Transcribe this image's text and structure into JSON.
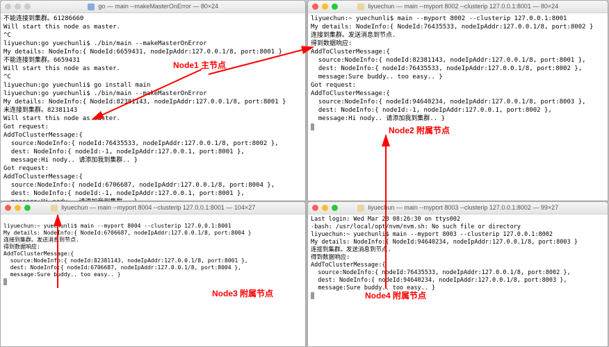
{
  "windows": {
    "tl": {
      "title": " go — main --makeMasterOnError — 80×24",
      "lights": "grey",
      "lines": [
        "不能连接到集群。61286660",
        "Will start this node as master.",
        "^C",
        "liyuechun:go yuechunli$ ./bin/main --makeMasterOnError",
        "My details: NodeInfo:{ NodeId:6659431, nodeIpAddr:127.0.0.1/8, port:8001 }",
        "不能连接到集群。6659431",
        "Will start this node as master.",
        "^C",
        "liyuechun:go yuechunli$ go install main",
        "liyuechun:go yuechunli$ ./bin/main --makeMasterOnError",
        "My details: NodeInfo:{ NodeId:82381143, nodeIpAddr:127.0.0.1/8, port:8001 }",
        "未连接到集群。82381143",
        "Will start this node as master.",
        "Got request:",
        "AddToClusterMessage:{",
        "  source:NodeInfo:{ nodeId:76435533, nodeIpAddr:127.0.0.1/8, port:8002 },",
        "  dest: NodeInfo:{ nodeId:-1, nodeIpAddr:127.0.0.1, port:8001 },",
        "  message:Hi nody.. 请添加我到集群.. }",
        "Got request:",
        "AddToClusterMessage:{",
        "  source:NodeInfo:{ nodeId:6706687, nodeIpAddr:127.0.0.1/8, port:8004 },",
        "  dest: NodeInfo:{ nodeId:-1, nodeIpAddr:127.0.0.1, port:8001 },",
        "  message:Hi nody.. 请添加我到集群.. }"
      ]
    },
    "tr": {
      "title": " liyuechun — main --myport 8002 --clusterip 127.0.0.1:8001 — 80×24",
      "lights": "color",
      "lines": [
        "liyuechun:~ yuechunli$ main --myport 8002 --clusterip 127.0.0.1:8001",
        "My details: NodeInfo:{ NodeId:76435533, nodeIpAddr:127.0.0.1/8, port:8002 }",
        "连接到集群。发送消息到节点.",
        "得到数据响应:",
        "AddToClusterMessage:{",
        "  source:NodeInfo:{ nodeId:82381143, nodeIpAddr:127.0.0.1/8, port:8001 },",
        "  dest: NodeInfo:{ nodeId:76435533, nodeIpAddr:127.0.0.1/8, port:8002 },",
        "  message:Sure buddy.. too easy.. }",
        "Got request:",
        "AddToClusterMessage:{",
        "  source:NodeInfo:{ nodeId:94640234, nodeIpAddr:127.0.0.1/8, port:8003 },",
        "  dest: NodeInfo:{ nodeId:-1, nodeIpAddr:127.0.0.1, port:8002 },",
        "  message:Hi nody.. 请添加我到集群.. }"
      ]
    },
    "bl": {
      "title": " liyuechun — main --myport 8004 --clusterip 127.0.0.1:8001 — 104×27",
      "lights": "color",
      "lines": [
        "",
        "liyuechun:~ yuechunli$ main --myport 8004 --clusterip 127.0.0.1:8001",
        "My details: NodeInfo:{ NodeId:6706687, nodeIpAddr:127.0.0.1/8, port:8004 }",
        "连接到集群。发送消息到节点.",
        "得到数据响应:",
        "AddToClusterMessage:{",
        "  source:NodeInfo:{ nodeId:82381143, nodeIpAddr:127.0.0.1/8, port:8001 },",
        "  dest: NodeInfo:{ nodeId:6706687, nodeIpAddr:127.0.0.1/8, port:8004 },",
        "  message:Sure buddy.. too easy.. }"
      ]
    },
    "br": {
      "title": " liyuechun — main --myport 8003 --clusterip 127.0.0.1:8002 — 99×27",
      "lights": "color",
      "lines": [
        "Last login: Wed Mar 28 08:26:30 on ttys002",
        "-bash: /usr/local/opt/nvm/nvm.sh: No such file or directory",
        "liyuechun:~ yuechunli$ main --myport 8003 --clusterip 127.0.0.1:8002",
        "My details: NodeInfo:{ NodeId:94640234, nodeIpAddr:127.0.0.1/8, port:8003 }",
        "连接到集群。发送消息到节点.",
        "得到数据响应:",
        "AddToClusterMessage:{",
        "  source:NodeInfo:{ nodeId:76435533, nodeIpAddr:127.0.0.1/8, port:8002 },",
        "  dest: NodeInfo:{ nodeId:94640234, nodeIpAddr:127.0.0.1/8, port:8003 },",
        "  message:Sure buddy.. too easy.. }"
      ]
    }
  },
  "annotations": {
    "node1": "Node1 主节点",
    "node2": "Node2 附属节点",
    "node3": "Node3 附属节点",
    "node4": "Node4 附属节点"
  }
}
